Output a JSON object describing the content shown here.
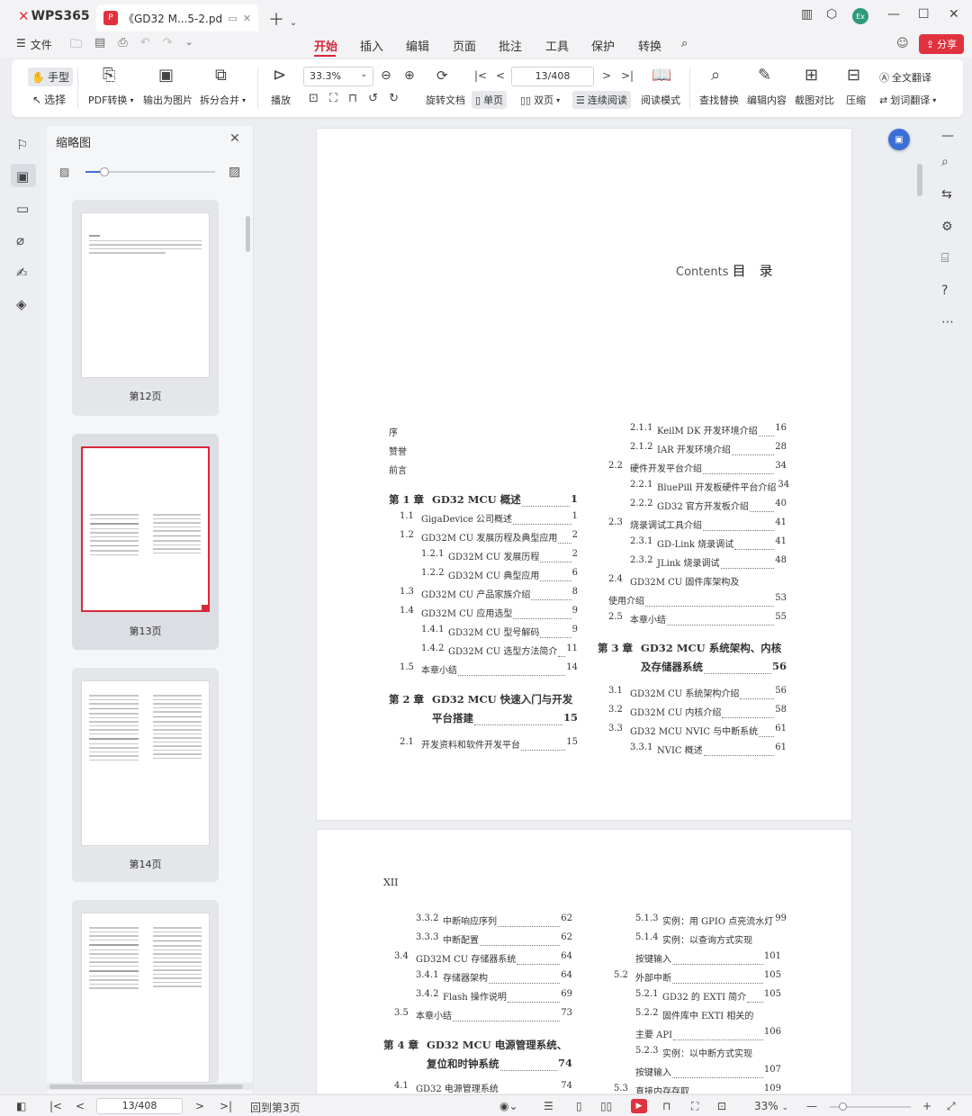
{
  "app": {
    "logo": "WPS365",
    "tab_title": "《GD32 M...5-2.pdf",
    "file_menu": "文件"
  },
  "menu": [
    "开始",
    "插入",
    "编辑",
    "页面",
    "批注",
    "工具",
    "保护",
    "转换"
  ],
  "share": "分享",
  "ribbon": {
    "hand": "手型",
    "select": "选择",
    "pdf_convert": "PDF转换",
    "export_image": "输出为图片",
    "split_merge": "拆分合并",
    "play": "播放",
    "zoom": "33.3%",
    "page": "13/408",
    "rotate": "旋转文档",
    "single": "单页",
    "double": "双页",
    "continuous": "连续阅读",
    "reading_mode": "阅读模式",
    "find_replace": "查找替换",
    "edit_content": "编辑内容",
    "compare": "截图对比",
    "compress": "压缩",
    "full_translate": "全文翻译",
    "word_translate": "划词翻译"
  },
  "thumbs": {
    "title": "缩略图",
    "pages": [
      "第12页",
      "第13页",
      "第14页"
    ]
  },
  "page1": {
    "heading_en": "Contents",
    "heading_cn": "目　录",
    "left": [
      {
        "n": "",
        "t": "序",
        "p": "",
        "lv": 0
      },
      {
        "n": "",
        "t": "赞誉",
        "p": "",
        "lv": 0
      },
      {
        "n": "",
        "t": "前言",
        "p": "",
        "lv": 0
      },
      {
        "n": "第 1 章",
        "t": "GD32 MCU 概述",
        "p": "1",
        "lv": "ch"
      },
      {
        "n": "1.1",
        "t": "GigaDevice 公司概述",
        "p": "1",
        "lv": 1
      },
      {
        "n": "1.2",
        "t": "GD32M CU 发展历程及典型应用",
        "p": "2",
        "lv": 1
      },
      {
        "n": "1.2.1",
        "t": "GD32M CU 发展历程",
        "p": "2",
        "lv": 2
      },
      {
        "n": "1.2.2",
        "t": "GD32M CU 典型应用",
        "p": "6",
        "lv": 2
      },
      {
        "n": "1.3",
        "t": "GD32M CU 产品家族介绍",
        "p": "8",
        "lv": 1
      },
      {
        "n": "1.4",
        "t": "GD32M CU 应用选型",
        "p": "9",
        "lv": 1
      },
      {
        "n": "1.4.1",
        "t": "GD32M CU 型号解码",
        "p": "9",
        "lv": 2
      },
      {
        "n": "1.4.2",
        "t": "GD32M CU 选型方法简介",
        "p": "11",
        "lv": 2
      },
      {
        "n": "1.5",
        "t": "本章小结",
        "p": "14",
        "lv": 1
      },
      {
        "n": "第 2 章",
        "t": "GD32 MCU 快速入门与开发",
        "p": "",
        "lv": "ch"
      },
      {
        "n": "",
        "t": "平台搭建",
        "p": "15",
        "lv": "ch2"
      },
      {
        "n": "2.1",
        "t": "开发资料和软件开发平台",
        "p": "15",
        "lv": 1
      }
    ],
    "right": [
      {
        "n": "2.1.1",
        "t": "KeilM DK 开发环境介绍",
        "p": "16",
        "lv": 2
      },
      {
        "n": "2.1.2",
        "t": "IAR 开发环境介绍",
        "p": "28",
        "lv": 2
      },
      {
        "n": "2.2",
        "t": "硬件开发平台介绍",
        "p": "34",
        "lv": 1
      },
      {
        "n": "2.2.1",
        "t": "BluePill 开发板硬件平台介绍",
        "p": "34",
        "lv": 2
      },
      {
        "n": "2.2.2",
        "t": "GD32 官方开发板介绍",
        "p": "40",
        "lv": 2
      },
      {
        "n": "2.3",
        "t": "烧录调试工具介绍",
        "p": "41",
        "lv": 1
      },
      {
        "n": "2.3.1",
        "t": "GD-Link 烧录调试",
        "p": "41",
        "lv": 2
      },
      {
        "n": "2.3.2",
        "t": "JLink 烧录调试",
        "p": "48",
        "lv": 2
      },
      {
        "n": "2.4",
        "t": "GD32M CU 固件库架构及",
        "p": "",
        "lv": 1
      },
      {
        "n": "",
        "t": "使用介绍",
        "p": "53",
        "lv": 1
      },
      {
        "n": "2.5",
        "t": "本章小结",
        "p": "55",
        "lv": 1
      },
      {
        "n": "第 3 章",
        "t": "GD32 MCU 系统架构、内核",
        "p": "",
        "lv": "ch"
      },
      {
        "n": "",
        "t": "及存储器系统",
        "p": "56",
        "lv": "ch2"
      },
      {
        "n": "3.1",
        "t": "GD32M CU 系统架构介绍",
        "p": "56",
        "lv": 1
      },
      {
        "n": "3.2",
        "t": "GD32M CU 内核介绍",
        "p": "58",
        "lv": 1
      },
      {
        "n": "3.3",
        "t": "GD32 MCU NVIC 与中断系统",
        "p": "61",
        "lv": 1
      },
      {
        "n": "3.3.1",
        "t": "NVIC 概述",
        "p": "61",
        "lv": 2
      }
    ]
  },
  "page2": {
    "header": "XII",
    "left": [
      {
        "n": "3.3.2",
        "t": "中断响应序列",
        "p": "62",
        "lv": 2
      },
      {
        "n": "3.3.3",
        "t": "中断配置",
        "p": "62",
        "lv": 2
      },
      {
        "n": "3.4",
        "t": "GD32M CU 存储器系统",
        "p": "64",
        "lv": 1
      },
      {
        "n": "3.4.1",
        "t": "存储器架构",
        "p": "64",
        "lv": 2
      },
      {
        "n": "3.4.2",
        "t": "Flash 操作说明",
        "p": "69",
        "lv": 2
      },
      {
        "n": "3.5",
        "t": "本章小结",
        "p": "73",
        "lv": 1
      },
      {
        "n": "第 4 章",
        "t": "GD32 MCU 电源管理系统、",
        "p": "",
        "lv": "ch"
      },
      {
        "n": "",
        "t": "复位和时钟系统",
        "p": "74",
        "lv": "ch2"
      },
      {
        "n": "4.1",
        "t": "GD32 电源管理系统",
        "p": "74",
        "lv": 1
      }
    ],
    "right": [
      {
        "n": "5.1.3",
        "t": "实例：用 GPIO 点亮流水灯",
        "p": "99",
        "lv": 2
      },
      {
        "n": "5.1.4",
        "t": "实例：以查询方式实现",
        "p": "",
        "lv": 2
      },
      {
        "n": "",
        "t": "按键输入",
        "p": "101",
        "lv": 2
      },
      {
        "n": "5.2",
        "t": "外部中断",
        "p": "105",
        "lv": 1
      },
      {
        "n": "5.2.1",
        "t": "GD32 的 EXTI 简介",
        "p": "105",
        "lv": 2
      },
      {
        "n": "5.2.2",
        "t": "固件库中 EXTI 相关的",
        "p": "",
        "lv": 2
      },
      {
        "n": "",
        "t": "主要 API",
        "p": "106",
        "lv": 2
      },
      {
        "n": "5.2.3",
        "t": "实例：以中断方式实现",
        "p": "",
        "lv": 2
      },
      {
        "n": "",
        "t": "按键输入",
        "p": "107",
        "lv": 2
      },
      {
        "n": "5.3",
        "t": "直接内存存取",
        "p": "109",
        "lv": 1
      }
    ]
  },
  "status": {
    "page": "13/408",
    "back": "回到第3页",
    "zoom": "33%"
  }
}
